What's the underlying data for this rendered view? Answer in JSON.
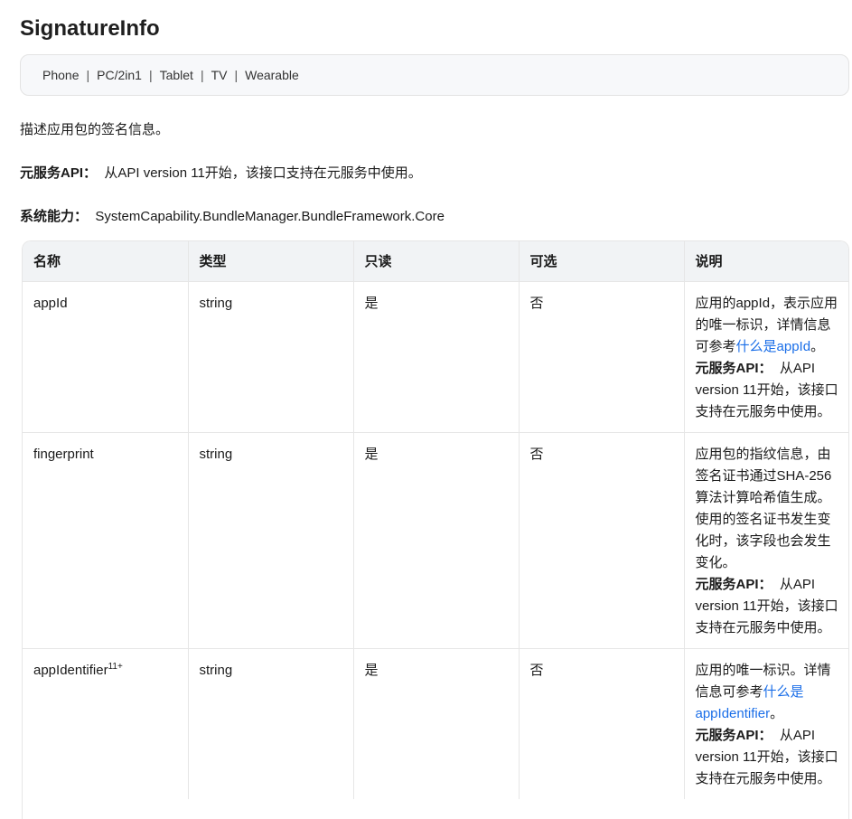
{
  "page": {
    "title": "SignatureInfo"
  },
  "devices": [
    "Phone",
    "PC/2in1",
    "Tablet",
    "TV",
    "Wearable"
  ],
  "description": "描述应用包的签名信息。",
  "meta_service": {
    "label": "元服务API：",
    "text": "从API version 11开始，该接口支持在元服务中使用。"
  },
  "syscap": {
    "label": "系统能力：",
    "text": "SystemCapability.BundleManager.BundleFramework.Core"
  },
  "table": {
    "headers": [
      "名称",
      "类型",
      "只读",
      "可选",
      "说明"
    ],
    "rows": [
      {
        "name": "appId",
        "name_sup": "",
        "type": "string",
        "readonly": "是",
        "optional": "否",
        "desc_pre": "应用的appId，表示应用的唯一标识，详情信息可参考",
        "desc_link": "什么是appId",
        "desc_post": "。",
        "meta_label": "元服务API：",
        "meta_text": "从API version 11开始，该接口支持在元服务中使用。"
      },
      {
        "name": "fingerprint",
        "name_sup": "",
        "type": "string",
        "readonly": "是",
        "optional": "否",
        "desc_pre": "应用包的指纹信息，由签名证书通过SHA-256算法计算哈希值生成。使用的签名证书发生变化时，该字段也会发生变化。",
        "desc_link": "",
        "desc_post": "",
        "meta_label": "元服务API：",
        "meta_text": "从API version 11开始，该接口支持在元服务中使用。"
      },
      {
        "name": "appIdentifier",
        "name_sup": "11+",
        "type": "string",
        "readonly": "是",
        "optional": "否",
        "desc_pre": "应用的唯一标识。详情信息可参考",
        "desc_link": "什么是appIdentifier",
        "desc_post": "。",
        "meta_label": "元服务API：",
        "meta_text": "从API version 11开始，该接口支持在元服务中使用。"
      }
    ]
  }
}
